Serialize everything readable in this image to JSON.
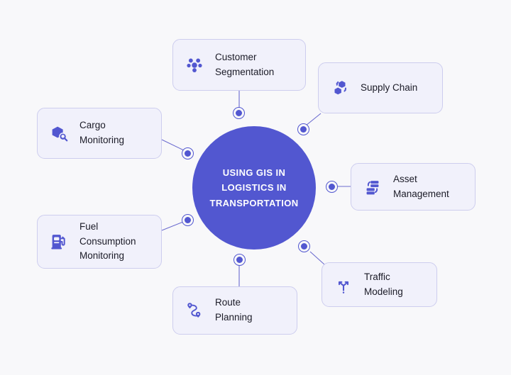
{
  "diagram": {
    "title": "Using GIS in Logistics in Transportation",
    "background_color": "#f8f8fa",
    "accent_color": "#5257d0",
    "card_fill_color": "#f1f1fb",
    "card_border_color": "#cdcdee",
    "hub": {
      "label": "USING GIS IN\nLOGISTICS IN\nTRANSPORTATION"
    },
    "nodes": [
      {
        "id": "customer-segmentation",
        "label": "Customer\nSegmentation",
        "icon": "people-group-icon"
      },
      {
        "id": "supply-chain",
        "label": "Supply Chain",
        "icon": "boxes-cycle-icon"
      },
      {
        "id": "cargo-monitoring",
        "label": "Cargo\nMonitoring",
        "icon": "box-magnifier-icon"
      },
      {
        "id": "asset-management",
        "label": "Asset\nManagement",
        "icon": "server-refresh-icon"
      },
      {
        "id": "fuel-consumption-monitoring",
        "label": "Fuel\nConsumption\nMonitoring",
        "icon": "fuel-pump-icon"
      },
      {
        "id": "traffic-modeling",
        "label": "Traffic\nModeling",
        "icon": "road-fork-arrows-icon"
      },
      {
        "id": "route-planning",
        "label": "Route\nPlanning",
        "icon": "route-pins-icon"
      }
    ]
  }
}
